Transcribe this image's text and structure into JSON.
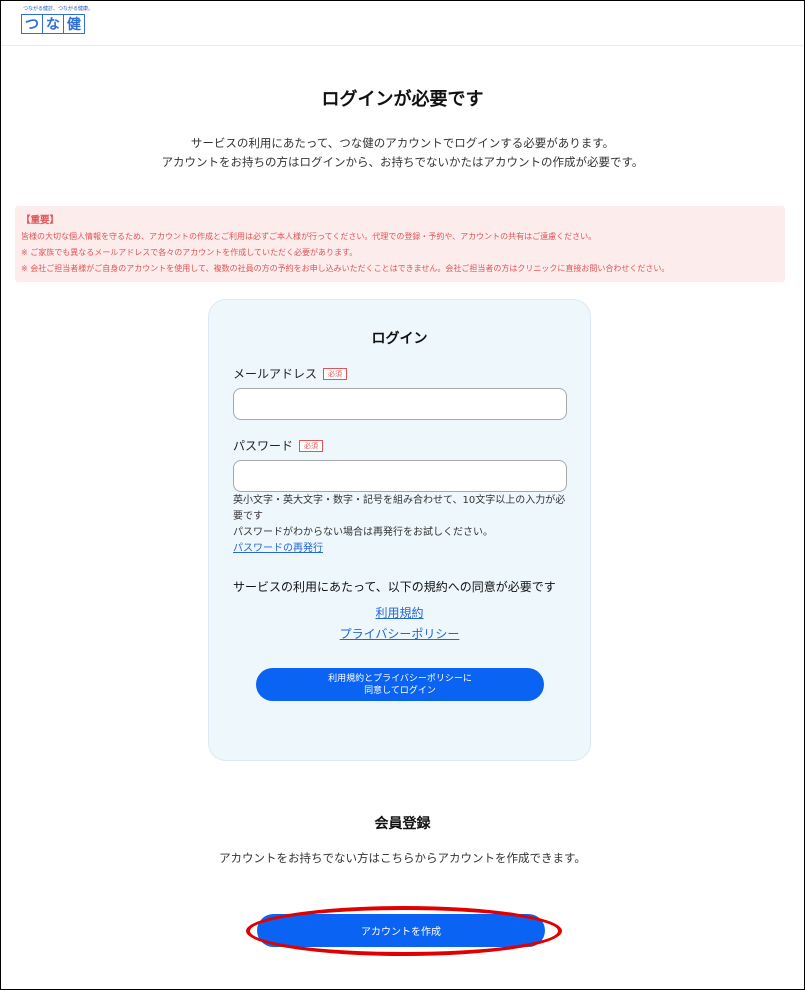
{
  "header": {
    "logo_tagline": "つながる健診、つながる健康。",
    "logo_chars": [
      "つ",
      "な",
      "健"
    ]
  },
  "page": {
    "title": "ログインが必要です",
    "intro_line1": "サービスの利用にあたって、つな健のアカウントでログインする必要があります。",
    "intro_line2": "アカウントをお持ちの方はログインから、お持ちでないかたはアカウントの作成が必要です。"
  },
  "notice": {
    "heading": "【重要】",
    "line1": "皆様の大切な個人情報を守るため、アカウントの作成とご利用は必ずご本人様が行ってください。代理での登録・予約や、アカウントの共有はご遠慮ください。",
    "line2": "※ ご家族でも異なるメールアドレスで各々のアカウントを作成していただく必要があります。",
    "line3": "※ 会社ご担当者様がご自身のアカウントを使用して、複数の社員の方の予約をお申し込みいただくことはできません。会社ご担当者の方はクリニックに直接お問い合わせください。"
  },
  "login": {
    "title": "ログイン",
    "email_label": "メールアドレス",
    "email_value": "",
    "password_label": "パスワード",
    "password_value": "",
    "required_badge": "必須",
    "hint_line1": "英小文字・英大文字・数字・記号を組み合わせて、10文字以上の入力が必要です",
    "hint_line2": "パスワードがわからない場合は再発行をお試しください。",
    "reset_link": "パスワードの再発行",
    "agree_text": "サービスの利用にあたって、以下の規約への同意が必要です",
    "terms_link": "利用規約",
    "privacy_link": "プライバシーポリシー",
    "submit_line1": "利用規約とプライバシーポリシーに",
    "submit_line2": "同意してログイン"
  },
  "register": {
    "title": "会員登録",
    "text": "アカウントをお持ちでない方はこちらからアカウントを作成できます。",
    "button": "アカウントを作成"
  },
  "colors": {
    "accent": "#0a63f2",
    "link": "#2467d6",
    "warning": "#e05555",
    "card_bg": "#eef7fc",
    "highlight": "#e00000"
  }
}
